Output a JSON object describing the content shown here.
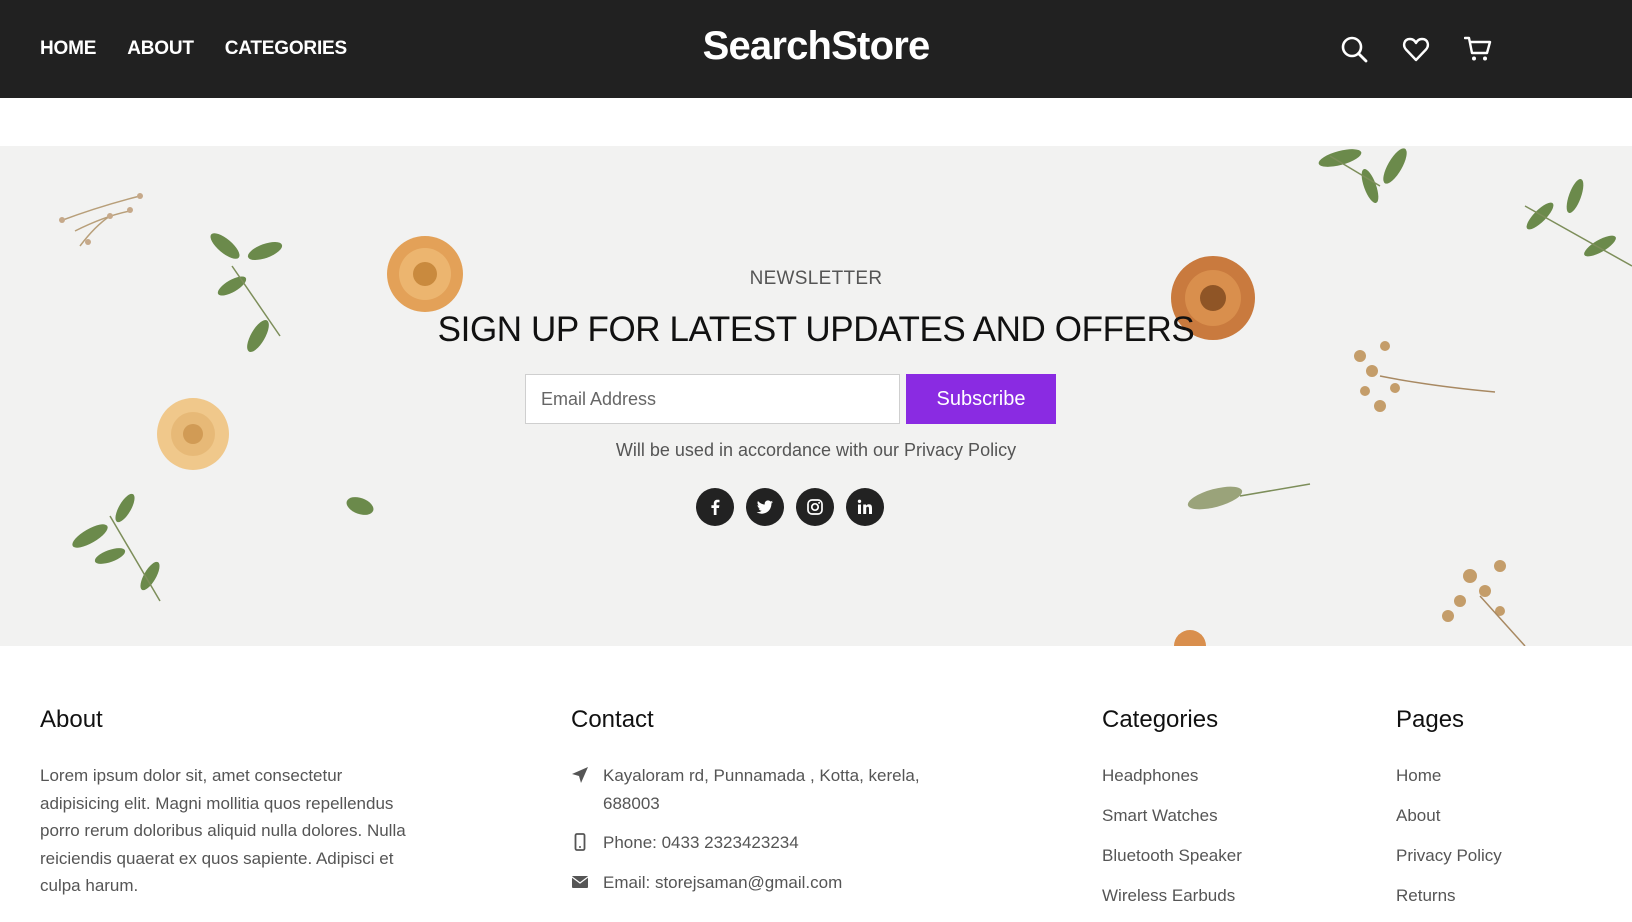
{
  "header": {
    "nav": [
      "HOME",
      "ABOUT",
      "CATEGORIES"
    ],
    "logo": "SearchStore",
    "icons": [
      "search-icon",
      "heart-icon",
      "cart-icon"
    ]
  },
  "newsletter": {
    "eyebrow": "NEWSLETTER",
    "headline": "SIGN UP FOR LATEST UPDATES AND OFFERS",
    "email_placeholder": "Email Address",
    "email_value": "",
    "subscribe_label": "Subscribe",
    "disclaimer": "Will be used in accordance with our Privacy Policy",
    "socials": [
      "facebook-icon",
      "twitter-icon",
      "instagram-icon",
      "linkedin-icon"
    ],
    "accent_color": "#8a2be2"
  },
  "footer": {
    "about": {
      "title": "About",
      "text": "Lorem ipsum dolor sit, amet consectetur adipisicing elit. Magni mollitia quos repellendus porro rerum doloribus aliquid nulla dolores. Nulla reiciendis quaerat ex quos sapiente. Adipisci et culpa harum."
    },
    "contact": {
      "title": "Contact",
      "address": "Kayaloram rd, Punnamada , Kotta, kerela, 688003",
      "phone": "Phone: 0433 2323423234",
      "email": "Email: storejsaman@gmail.com"
    },
    "categories": {
      "title": "Categories",
      "items": [
        "Headphones",
        "Smart Watches",
        "Bluetooth Speaker",
        "Wireless Earbuds"
      ]
    },
    "pages": {
      "title": "Pages",
      "items": [
        "Home",
        "About",
        "Privacy Policy",
        "Returns"
      ]
    }
  }
}
